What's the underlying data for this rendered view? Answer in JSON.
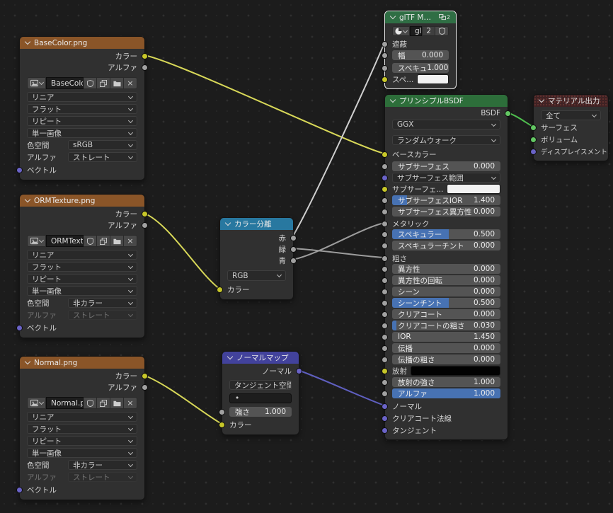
{
  "colors": {
    "accent_blue": "#4772b3",
    "socket_yellow": "#c7c729",
    "socket_gray": "#a1a1a1",
    "socket_purple": "#6a63c7",
    "socket_green": "#63c763",
    "header_texture": "#8a5528",
    "header_converter": "#2878a0",
    "header_vector": "#42429c",
    "header_shader": "#2d6e3a",
    "header_group": "#2f6e44",
    "header_output": "#3f2224"
  },
  "texture_nodes": {
    "basecolor": {
      "title": "BaseColor.png",
      "out_color": "カラー",
      "out_alpha": "アルファ",
      "image_name": "BaseColor.png",
      "interp": "リニア",
      "projection": "フラット",
      "extension": "リピート",
      "source": "単一画像",
      "colorspace_label": "色空間",
      "colorspace": "sRGB",
      "alpha_label": "アルファ",
      "alpha_mode": "ストレート",
      "in_vector": "ベクトル"
    },
    "orm": {
      "title": "ORMTexture.png",
      "out_color": "カラー",
      "out_alpha": "アルファ",
      "image_name": "ORMTexture.png",
      "interp": "リニア",
      "projection": "フラット",
      "extension": "リピート",
      "source": "単一画像",
      "colorspace_label": "色空間",
      "colorspace": "非カラー",
      "alpha_label": "アルファ",
      "alpha_mode": "ストレート",
      "in_vector": "ベクトル"
    },
    "normal": {
      "title": "Normal.png",
      "out_color": "カラー",
      "out_alpha": "アルファ",
      "image_name": "Normal.png",
      "interp": "リニア",
      "projection": "フラット",
      "extension": "リピート",
      "source": "単一画像",
      "colorspace_label": "色空間",
      "colorspace": "非カラー",
      "alpha_label": "アルファ",
      "alpha_mode": "ストレート",
      "in_vector": "ベクトル"
    }
  },
  "separate_color": {
    "title": "カラー分離",
    "out_r": "赤",
    "out_g": "緑",
    "out_b": "青",
    "mode": "RGB",
    "in_color": "カラー"
  },
  "normal_map": {
    "title": "ノーマルマップ",
    "out_normal": "ノーマル",
    "space": "タンジェント空間",
    "uv": "•",
    "strength_label": "強さ",
    "strength": "1.000",
    "in_color": "カラー"
  },
  "gltf": {
    "title": "glTF Material Out...",
    "group_count": "2",
    "mat_name": "glT...",
    "mat_users": "2",
    "in_occlusion": "遮蔽",
    "width_label": "幅",
    "width": "0.000",
    "spec_label": "スペキュ",
    "spec": "1.000",
    "speccolor_label": "スペ..."
  },
  "bsdf": {
    "title": "プリンシプルBSDF",
    "out": "BSDF",
    "distribution": "GGX",
    "sss_method": "ランダムウォーク",
    "rows": [
      {
        "label": "ベースカラー"
      },
      {
        "label": "サブサーフェス",
        "value": "0.000"
      },
      {
        "label": "サブサーフェス範囲"
      },
      {
        "label": "サブサーフェ..."
      },
      {
        "label": "サブサーフェスIOR",
        "value": "1.400"
      },
      {
        "label": "サブサーフェス異方性",
        "value": "0.000"
      },
      {
        "label": "メタリック"
      },
      {
        "label": "スペキュラー",
        "value": "0.500"
      },
      {
        "label": "スペキュラーチント",
        "value": "0.000"
      },
      {
        "label": "粗さ"
      },
      {
        "label": "異方性",
        "value": "0.000"
      },
      {
        "label": "異方性の回転",
        "value": "0.000"
      },
      {
        "label": "シーン",
        "value": "0.000"
      },
      {
        "label": "シーンチント",
        "value": "0.500"
      },
      {
        "label": "クリアコート",
        "value": "0.000"
      },
      {
        "label": "クリアコートの粗さ",
        "value": "0.030"
      },
      {
        "label": "IOR",
        "value": "1.450"
      },
      {
        "label": "伝播",
        "value": "0.000"
      },
      {
        "label": "伝播の粗さ",
        "value": "0.000"
      },
      {
        "label": "放射"
      },
      {
        "label": "放射の強さ",
        "value": "1.000"
      },
      {
        "label": "アルファ",
        "value": "1.000"
      },
      {
        "label": "ノーマル"
      },
      {
        "label": "クリアコート法線"
      },
      {
        "label": "タンジェント"
      }
    ]
  },
  "material_output": {
    "title": "マテリアル出力",
    "target": "全て",
    "in_surface": "サーフェス",
    "in_volume": "ボリューム",
    "in_displacement": "ディスプレイスメント"
  }
}
